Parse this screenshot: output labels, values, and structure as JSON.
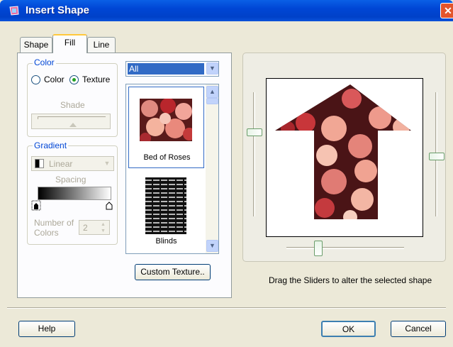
{
  "window": {
    "title": "Insert Shape",
    "close_glyph": "✕"
  },
  "tabs": [
    {
      "label": "Shape"
    },
    {
      "label": "Fill"
    },
    {
      "label": "Line"
    }
  ],
  "color_group": {
    "label": "Color",
    "radio_color_label": "Color",
    "radio_texture_label": "Texture",
    "selected": "Texture",
    "shade_label": "Shade"
  },
  "gradient_group": {
    "label": "Gradient",
    "type_value": "Linear",
    "spacing_label": "Spacing",
    "number_of_colors_label": "Number of Colors",
    "number_of_colors_value": "2"
  },
  "texture_filter": {
    "value": "All"
  },
  "textures": [
    {
      "name": "Bed of Roses",
      "selected": true
    },
    {
      "name": "Blinds",
      "selected": false
    }
  ],
  "custom_texture_button": "Custom Texture..",
  "preview": {
    "hint": "Drag the Sliders to alter the selected shape"
  },
  "buttons": {
    "help": "Help",
    "ok": "OK",
    "cancel": "Cancel"
  },
  "colors": {
    "title_bar": "#0046d5",
    "dialog_bg": "#ece9d8",
    "group_label": "#0046d5",
    "accent_tab": "#ffc83c"
  }
}
